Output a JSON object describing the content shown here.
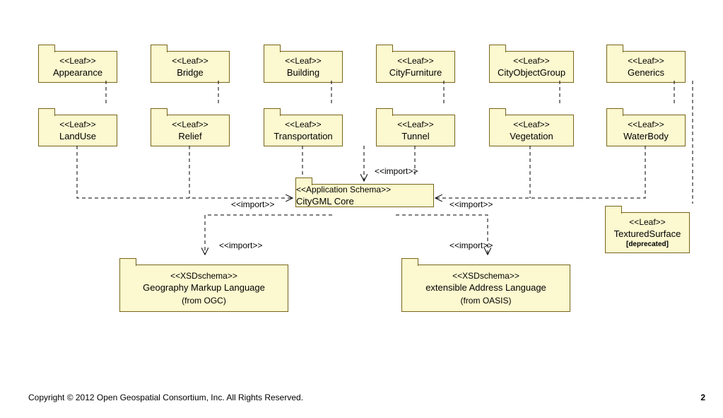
{
  "row1": [
    {
      "stereo": "<<Leaf>>",
      "name": "Appearance"
    },
    {
      "stereo": "<<Leaf>>",
      "name": "Bridge"
    },
    {
      "stereo": "<<Leaf>>",
      "name": "Building"
    },
    {
      "stereo": "<<Leaf>>",
      "name": "CityFurniture"
    },
    {
      "stereo": "<<Leaf>>",
      "name": "CityObjectGroup"
    },
    {
      "stereo": "<<Leaf>>",
      "name": "Generics"
    }
  ],
  "row2": [
    {
      "stereo": "<<Leaf>>",
      "name": "LandUse"
    },
    {
      "stereo": "<<Leaf>>",
      "name": "Relief"
    },
    {
      "stereo": "<<Leaf>>",
      "name": "Transportation"
    },
    {
      "stereo": "<<Leaf>>",
      "name": "Tunnel"
    },
    {
      "stereo": "<<Leaf>>",
      "name": "Vegetation"
    },
    {
      "stereo": "<<Leaf>>",
      "name": "WaterBody"
    }
  ],
  "core": {
    "stereo": "<<Application Schema>>",
    "name": "CityGML Core"
  },
  "gml": {
    "stereo": "<<XSDschema>>",
    "name": "Geography Markup Language",
    "from": "(from OGC)"
  },
  "xal": {
    "stereo": "<<XSDschema>>",
    "name": "extensible Address Language",
    "from": "(from OASIS)"
  },
  "tex": {
    "stereo": "<<Leaf>>",
    "name": "TexturedSurface",
    "note": "[deprecated]"
  },
  "labels": {
    "import": "<<import>>"
  },
  "footer": {
    "left": "Copyright © 2012 Open Geospatial Consortium, Inc. All Rights Reserved.",
    "right": "2"
  }
}
